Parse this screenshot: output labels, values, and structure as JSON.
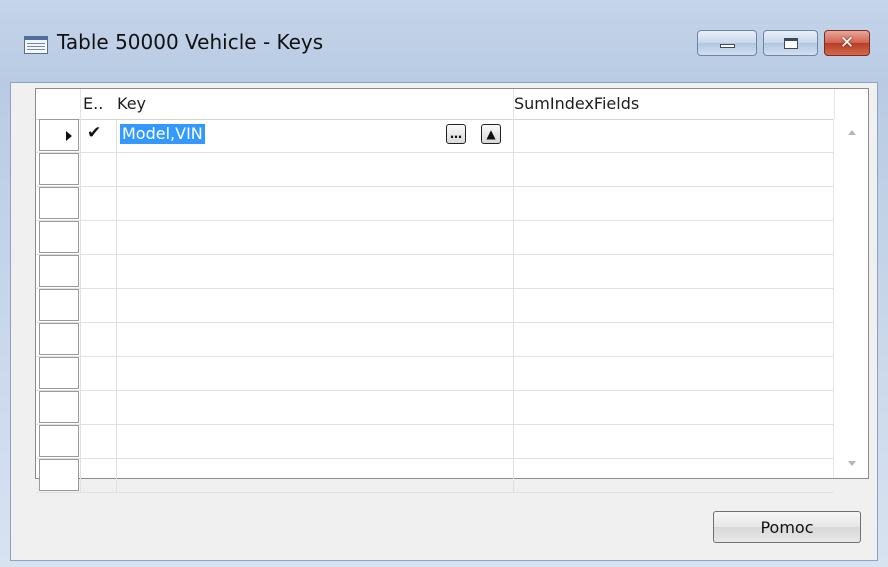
{
  "window": {
    "title": "Table 50000 Vehicle - Keys",
    "minimize_icon": "minimize-icon",
    "maximize_icon": "maximize-icon",
    "close_icon": "close-icon",
    "close_glyph": "✕"
  },
  "grid": {
    "columns": {
      "enabled": "E..",
      "key": "Key",
      "sum_index_fields": "SumIndexFields"
    },
    "rows": [
      {
        "enabled_mark": "✔",
        "key": "Model,VIN",
        "sum_index_fields": "",
        "current": true
      }
    ],
    "empty_row_count": 10,
    "assist_button_glyph": "…",
    "up_button_glyph": "▲"
  },
  "footer": {
    "help_label": "Pomoc"
  }
}
